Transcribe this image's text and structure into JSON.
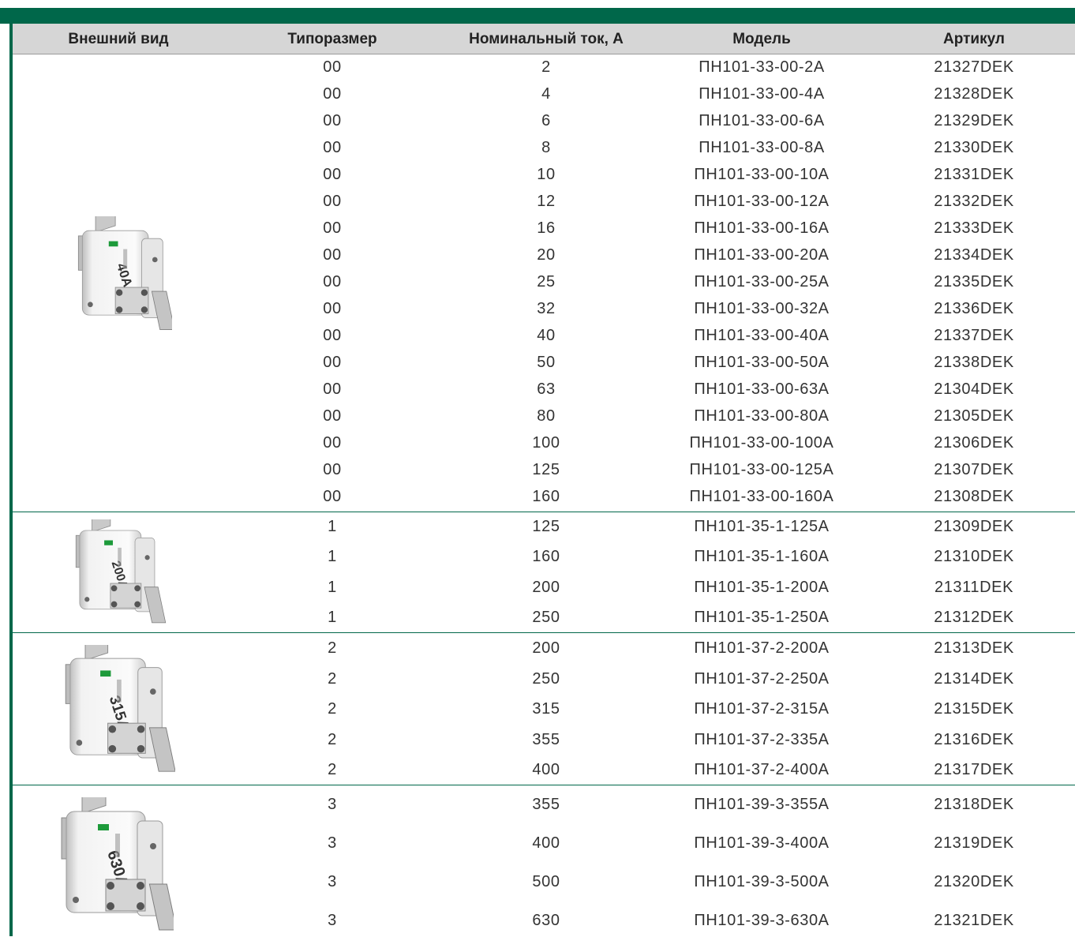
{
  "headers": {
    "appearance": "Внешний вид",
    "size": "Типоразмер",
    "current": "Номинальный ток, А",
    "model": "Модель",
    "article": "Артикул"
  },
  "groups": [
    {
      "image": {
        "label": "40A",
        "icon": "fuse-image"
      },
      "rows": [
        {
          "size": "00",
          "current": "2",
          "model": "ПН101-33-00-2А",
          "article": "21327DEK"
        },
        {
          "size": "00",
          "current": "4",
          "model": "ПН101-33-00-4А",
          "article": "21328DEK"
        },
        {
          "size": "00",
          "current": "6",
          "model": "ПН101-33-00-6А",
          "article": "21329DEK"
        },
        {
          "size": "00",
          "current": "8",
          "model": "ПН101-33-00-8А",
          "article": "21330DEK"
        },
        {
          "size": "00",
          "current": "10",
          "model": "ПН101-33-00-10А",
          "article": "21331DEK"
        },
        {
          "size": "00",
          "current": "12",
          "model": "ПН101-33-00-12А",
          "article": "21332DEK"
        },
        {
          "size": "00",
          "current": "16",
          "model": "ПН101-33-00-16А",
          "article": "21333DEK"
        },
        {
          "size": "00",
          "current": "20",
          "model": "ПН101-33-00-20А",
          "article": "21334DEK"
        },
        {
          "size": "00",
          "current": "25",
          "model": "ПН101-33-00-25А",
          "article": "21335DEK"
        },
        {
          "size": "00",
          "current": "32",
          "model": "ПН101-33-00-32А",
          "article": "21336DEK"
        },
        {
          "size": "00",
          "current": "40",
          "model": "ПН101-33-00-40А",
          "article": "21337DEK"
        },
        {
          "size": "00",
          "current": "50",
          "model": "ПН101-33-00-50А",
          "article": "21338DEK"
        },
        {
          "size": "00",
          "current": "63",
          "model": "ПН101-33-00-63А",
          "article": "21304DEK"
        },
        {
          "size": "00",
          "current": "80",
          "model": "ПН101-33-00-80А",
          "article": "21305DEK"
        },
        {
          "size": "00",
          "current": "100",
          "model": "ПН101-33-00-100А",
          "article": "21306DEK"
        },
        {
          "size": "00",
          "current": "125",
          "model": "ПН101-33-00-125А",
          "article": "21307DEK"
        },
        {
          "size": "00",
          "current": "160",
          "model": "ПН101-33-00-160А",
          "article": "21308DEK"
        }
      ]
    },
    {
      "image": {
        "label": "200A",
        "icon": "fuse-image"
      },
      "rows": [
        {
          "size": "1",
          "current": "125",
          "model": "ПН101-35-1-125А",
          "article": "21309DEK"
        },
        {
          "size": "1",
          "current": "160",
          "model": "ПН101-35-1-160А",
          "article": "21310DEK"
        },
        {
          "size": "1",
          "current": "200",
          "model": "ПН101-35-1-200А",
          "article": "21311DEK"
        },
        {
          "size": "1",
          "current": "250",
          "model": "ПН101-35-1-250А",
          "article": "21312DEK"
        }
      ]
    },
    {
      "image": {
        "label": "315A",
        "icon": "fuse-image"
      },
      "rows": [
        {
          "size": "2",
          "current": "200",
          "model": "ПН101-37-2-200А",
          "article": "21313DEK"
        },
        {
          "size": "2",
          "current": "250",
          "model": "ПН101-37-2-250А",
          "article": "21314DEK"
        },
        {
          "size": "2",
          "current": "315",
          "model": "ПН101-37-2-315А",
          "article": "21315DEK"
        },
        {
          "size": "2",
          "current": "355",
          "model": "ПН101-37-2-335А",
          "article": "21316DEK"
        },
        {
          "size": "2",
          "current": "400",
          "model": "ПН101-37-2-400А",
          "article": "21317DEK"
        }
      ]
    },
    {
      "image": {
        "label": "630A",
        "icon": "fuse-image"
      },
      "rows": [
        {
          "size": "3",
          "current": "355",
          "model": "ПН101-39-3-355А",
          "article": "21318DEK"
        },
        {
          "size": "3",
          "current": "400",
          "model": "ПН101-39-3-400А",
          "article": "21319DEK"
        },
        {
          "size": "3",
          "current": "500",
          "model": "ПН101-39-3-500А",
          "article": "21320DEK"
        },
        {
          "size": "3",
          "current": "630",
          "model": "ПН101-39-3-630А",
          "article": "21321DEK"
        }
      ]
    }
  ],
  "colors": {
    "accent": "#00674a",
    "header_bg": "#d6d6d6",
    "text": "#333333"
  }
}
